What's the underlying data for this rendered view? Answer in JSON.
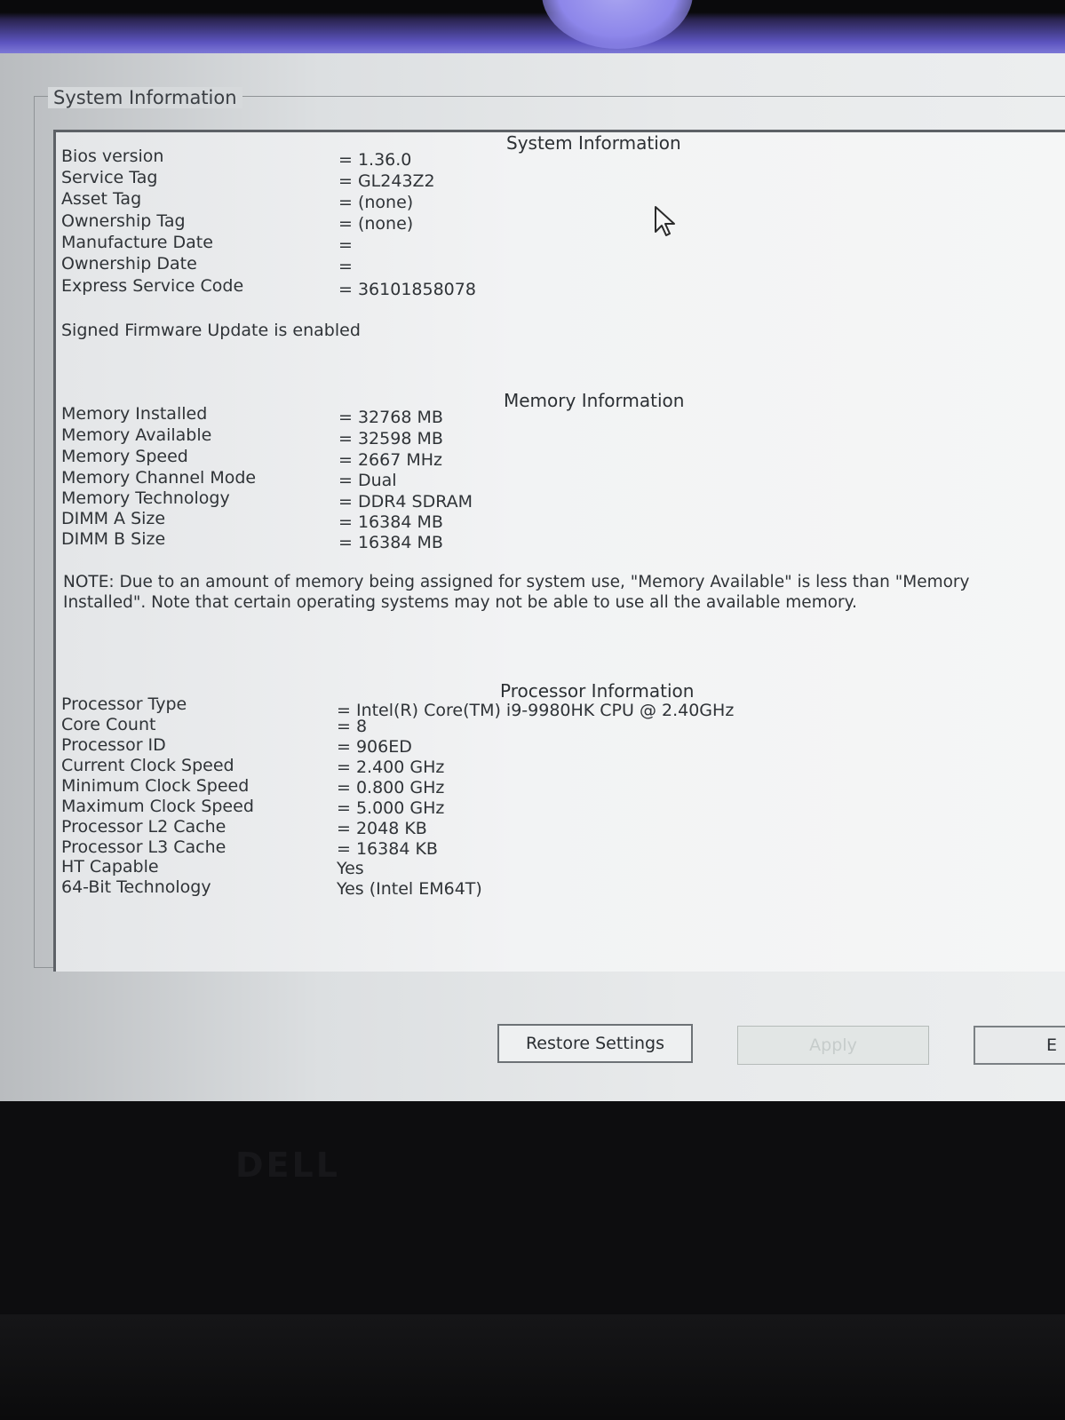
{
  "group_title": "System Information",
  "system": {
    "heading": "System Information",
    "rows": [
      {
        "label": "Bios version",
        "value": "= 1.36.0"
      },
      {
        "label": "Service Tag",
        "value": "= GL243Z2"
      },
      {
        "label": "Asset Tag",
        "value": "= (none)"
      },
      {
        "label": "Ownership Tag",
        "value": "= (none)"
      },
      {
        "label": "Manufacture Date",
        "value": "="
      },
      {
        "label": "Ownership Date",
        "value": "="
      },
      {
        "label": "Express Service Code",
        "value": "= 36101858078"
      }
    ],
    "firmware_note": "Signed Firmware Update is enabled"
  },
  "memory": {
    "heading": "Memory Information",
    "rows": [
      {
        "label": "Memory Installed",
        "value": "= 32768 MB"
      },
      {
        "label": "Memory Available",
        "value": "= 32598 MB"
      },
      {
        "label": "Memory Speed",
        "value": "= 2667 MHz"
      },
      {
        "label": "Memory Channel Mode",
        "value": "= Dual"
      },
      {
        "label": "Memory Technology",
        "value": "= DDR4 SDRAM"
      },
      {
        "label": "DIMM A Size",
        "value": "= 16384 MB"
      },
      {
        "label": "DIMM B Size",
        "value": "= 16384 MB"
      }
    ],
    "note": "NOTE: Due to an amount of memory being assigned for system use, \"Memory Available\" is less than \"Memory Installed\". Note that certain operating systems may not be able to use all the available memory."
  },
  "processor": {
    "heading": "Processor Information",
    "rows": [
      {
        "label": "Processor Type",
        "value": "= Intel(R) Core(TM) i9-9980HK CPU @ 2.40GHz"
      },
      {
        "label": "Core Count",
        "value": "= 8"
      },
      {
        "label": "Processor ID",
        "value": "= 906ED"
      },
      {
        "label": "Current Clock Speed",
        "value": "= 2.400 GHz"
      },
      {
        "label": "Minimum Clock Speed",
        "value": "= 0.800 GHz"
      },
      {
        "label": "Maximum Clock Speed",
        "value": "= 5.000 GHz"
      },
      {
        "label": "Processor L2 Cache",
        "value": "= 2048 KB"
      },
      {
        "label": "Processor L3 Cache",
        "value": "= 16384 KB"
      },
      {
        "label": "HT Capable",
        "value": "Yes"
      },
      {
        "label": "64-Bit Technology",
        "value": "Yes (Intel EM64T)"
      }
    ]
  },
  "buttons": {
    "restore": "Restore Settings",
    "apply": "Apply",
    "exit": "E"
  },
  "bezel_logo": "DELL",
  "icons": {
    "pointer": "mouse-pointer-icon"
  }
}
